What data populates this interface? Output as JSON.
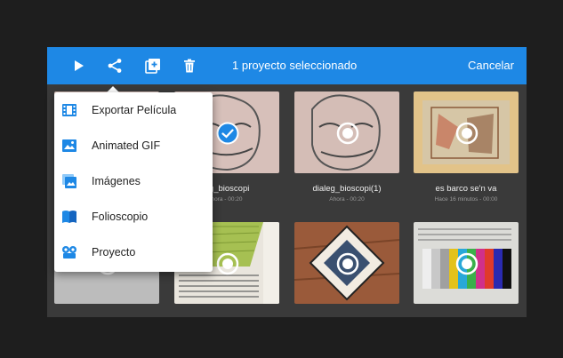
{
  "toolbar": {
    "icons": [
      "play-icon",
      "share-icon",
      "duplicate-icon",
      "trash-icon"
    ],
    "title": "1 proyecto seleccionado",
    "cancel_label": "Cancelar",
    "bg_color": "#1e88e5"
  },
  "projects": [
    {
      "name": "dialeg_bioscopi",
      "meta": "Ahora - 00:20",
      "selected": true
    },
    {
      "name": "dialeg_bioscopi(1)",
      "meta": "Ahora - 00:20",
      "selected": false
    },
    {
      "name": "es barco se'n va",
      "meta": "Hace 16 minutos - 00:00",
      "selected": false
    }
  ],
  "visible_captions": {
    "project1_name": "eg_bioscopi",
    "project1_meta": "hora - 00:20"
  },
  "share_menu": {
    "items": [
      {
        "label": "Exportar Película",
        "icon": "film-icon",
        "color": "#1e88e5"
      },
      {
        "label": "Animated GIF",
        "icon": "image-icon",
        "color": "#1e88e5"
      },
      {
        "label": "Imágenes",
        "icon": "images-icon",
        "color": "#1e88e5"
      },
      {
        "label": "Folioscopio",
        "icon": "book-icon",
        "color": "#1e88e5"
      },
      {
        "label": "Proyecto",
        "icon": "project-icon",
        "color": "#1e88e5"
      }
    ]
  }
}
